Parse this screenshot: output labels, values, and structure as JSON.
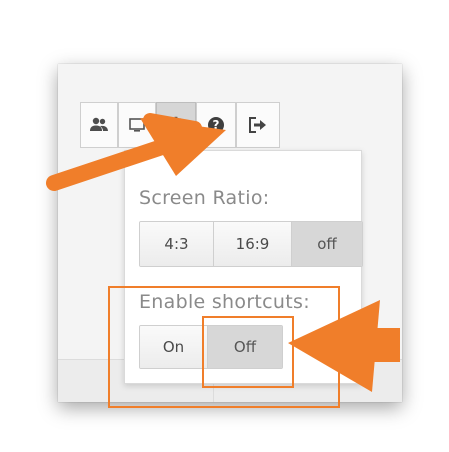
{
  "toolbar": {
    "buttons": [
      {
        "icon": "users-icon",
        "state": "normal"
      },
      {
        "icon": "screen-icon",
        "state": "normal"
      },
      {
        "icon": "gear-icon",
        "state": "active"
      },
      {
        "icon": "help-icon",
        "state": "normal"
      },
      {
        "icon": "logout-icon",
        "state": "normal"
      }
    ]
  },
  "dropdown": {
    "screen_ratio": {
      "label": "Screen Ratio:",
      "options": [
        "4:3",
        "16:9",
        "off"
      ],
      "selected": "off"
    },
    "shortcuts": {
      "label": "Enable shortcuts:",
      "options": [
        "On",
        "Off"
      ],
      "selected": "Off"
    }
  },
  "colors": {
    "annotation": "#f07e2a",
    "active_button": "#d6d6d6"
  }
}
